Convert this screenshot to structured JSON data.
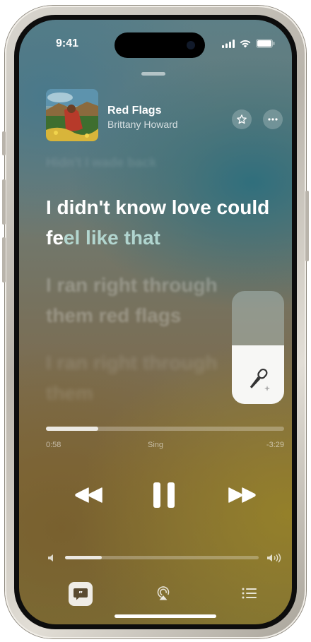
{
  "status_bar": {
    "time": "9:41"
  },
  "now_playing": {
    "title": "Red Flags",
    "artist": "Brittany Howard"
  },
  "lyrics": {
    "previous_line": "Hidn't I wade back",
    "current_sung": "I didn't know love could fe",
    "current_rest": "el like that",
    "next_line": "I ran right through them red flags",
    "next_line_2": "I ran right through them"
  },
  "playback": {
    "elapsed": "0:58",
    "remaining": "-3:29",
    "mode_label": "Sing",
    "progress_fraction": 0.22
  },
  "vocal_level_fraction": 0.52,
  "volume_fraction": 0.19,
  "icons": {
    "favorite": "star-icon",
    "more": "ellipsis-icon",
    "rewind": "rewind-icon",
    "pause": "pause-icon",
    "forward": "fast-forward-icon",
    "lyrics": "lyrics-quote-icon",
    "airplay": "airplay-icon",
    "queue": "queue-list-icon",
    "microphone": "microphone-icon"
  }
}
